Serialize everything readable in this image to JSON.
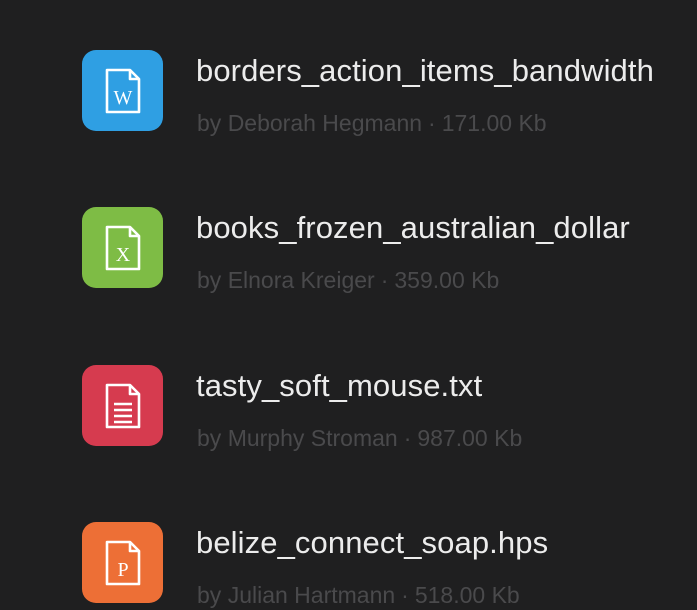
{
  "files": [
    {
      "name": "borders_action_items_bandwidth",
      "by_prefix": "by",
      "author": "Deborah Hegmann",
      "separator": "·",
      "size": "171.00 Kb",
      "icon": "word-document-icon",
      "icon_letter": "W",
      "color": "#2f9fe3"
    },
    {
      "name": "books_frozen_australian_dollar",
      "by_prefix": "by",
      "author": "Elnora Kreiger",
      "separator": "·",
      "size": "359.00 Kb",
      "icon": "excel-document-icon",
      "icon_letter": "X",
      "color": "#7ebc45"
    },
    {
      "name": "tasty_soft_mouse.txt",
      "by_prefix": "by",
      "author": "Murphy Stroman",
      "separator": "·",
      "size": "987.00 Kb",
      "icon": "text-document-icon",
      "icon_letter": "",
      "color": "#d63b4f"
    },
    {
      "name": "belize_connect_soap.hps",
      "by_prefix": "by",
      "author": "Julian Hartmann",
      "separator": "·",
      "size": "518.00 Kb",
      "icon": "powerpoint-document-icon",
      "icon_letter": "P",
      "color": "#ed6f36"
    }
  ]
}
